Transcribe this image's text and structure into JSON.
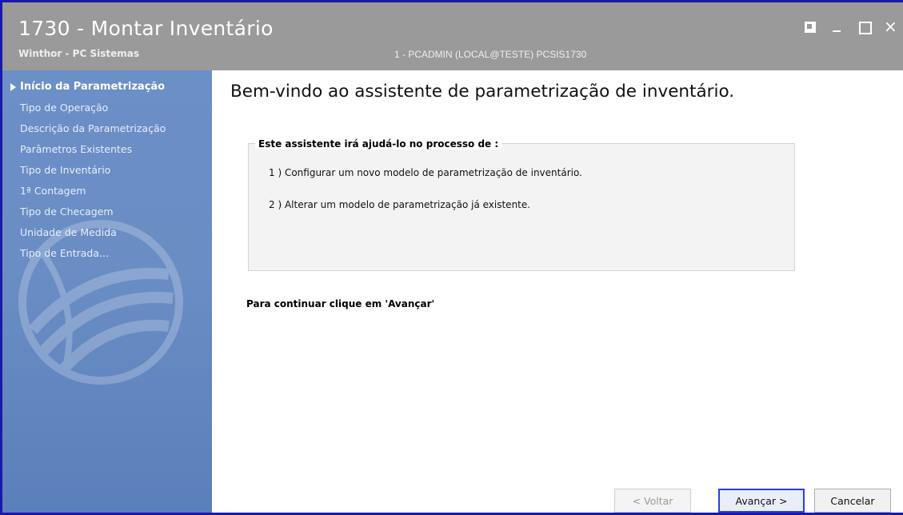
{
  "window": {
    "title": "1730 - Montar Inventário",
    "subtitle": "Winthor - PC Sistemas",
    "session_info": "1 - PCADMIN (LOCAL@TESTE)  PCSIS1730",
    "close_glyph": "×"
  },
  "sidebar": {
    "steps": [
      {
        "label": "Início da Parametrização",
        "active": true
      },
      {
        "label": "Tipo de Operação",
        "active": false
      },
      {
        "label": "Descrição da Parametrização",
        "active": false
      },
      {
        "label": "Parâmetros Existentes",
        "active": false
      },
      {
        "label": "Tipo de Inventário",
        "active": false
      },
      {
        "label": "1ª Contagem",
        "active": false
      },
      {
        "label": "Tipo de Checagem",
        "active": false
      },
      {
        "label": "Unidade de Medida",
        "active": false
      },
      {
        "label": "Tipo de Entrada...",
        "active": false
      }
    ]
  },
  "main": {
    "heading": "Bem-vindo ao assistente de parametrização de inventário.",
    "group": {
      "title": "Este assistente irá ajudá-lo no processo de :",
      "items": [
        "1 ) Configurar um novo modelo de parametrização de inventário.",
        "2 ) Alterar um modelo de parametrização já existente."
      ]
    },
    "continue_text": "Para continuar clique em 'Avançar'"
  },
  "buttons": {
    "back": "< Voltar",
    "next": "Avançar >",
    "cancel": "Cancelar"
  },
  "colors": {
    "titlebar": "#9a9a9a",
    "sidebar": "#6a8dc4",
    "accent_border": "#2a3ee0",
    "window_border": "#1a1aa8"
  }
}
